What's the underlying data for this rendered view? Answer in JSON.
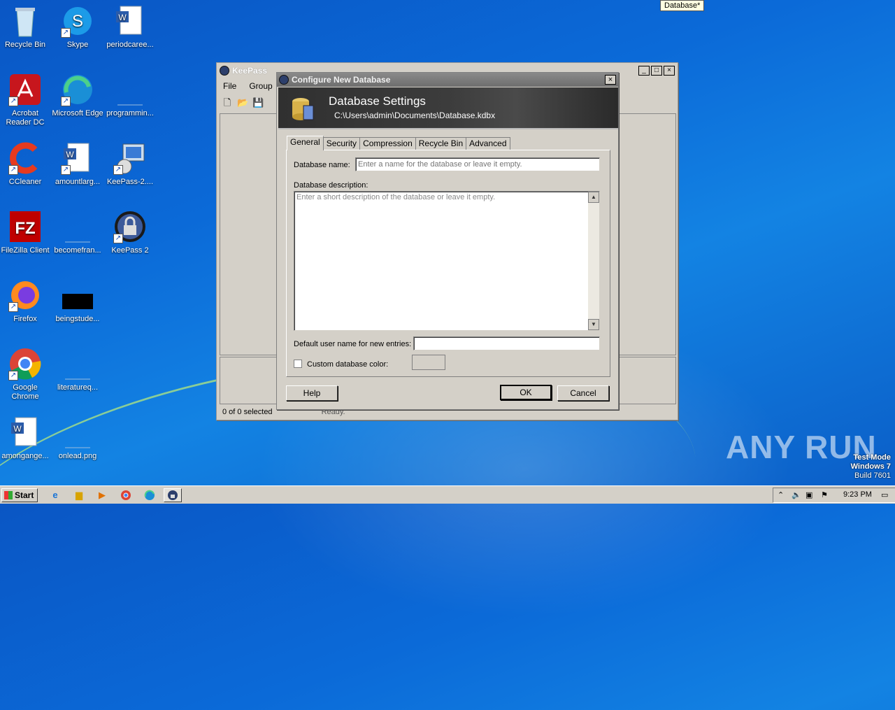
{
  "tooltip": "Database*",
  "desktop_icons": [
    {
      "label": "Recycle Bin",
      "icon": "recycle-bin-icon"
    },
    {
      "label": "Skype",
      "icon": "skype-icon"
    },
    {
      "label": "periodcaree...",
      "icon": "word-doc-icon"
    },
    {
      "label": "Acrobat Reader DC",
      "icon": "acrobat-icon"
    },
    {
      "label": "Microsoft Edge",
      "icon": "edge-icon"
    },
    {
      "label": "programmin...",
      "icon": "file-icon"
    },
    {
      "label": "CCleaner",
      "icon": "ccleaner-icon"
    },
    {
      "label": "amountlarg...",
      "icon": "word-doc-icon"
    },
    {
      "label": "KeePass-2....",
      "icon": "installer-icon"
    },
    {
      "label": "FileZilla Client",
      "icon": "filezilla-icon"
    },
    {
      "label": "becomefran...",
      "icon": "file-icon"
    },
    {
      "label": "KeePass 2",
      "icon": "keepass-icon"
    },
    {
      "label": "Firefox",
      "icon": "firefox-icon"
    },
    {
      "label": "beingstude...",
      "icon": "image-file-icon"
    },
    {
      "label": "Google Chrome",
      "icon": "chrome-icon"
    },
    {
      "label": "literatureq...",
      "icon": "file-icon"
    },
    {
      "label": "amongange...",
      "icon": "word-doc-icon"
    },
    {
      "label": "onlead.png",
      "icon": "file-icon"
    }
  ],
  "keepass": {
    "title": "KeePass",
    "menu": [
      "File",
      "Group"
    ],
    "status_left": "0 of 0 selected",
    "status_right": "Ready."
  },
  "dialog": {
    "title": "Configure New Database",
    "banner_title": "Database Settings",
    "banner_path": "C:\\Users\\admin\\Documents\\Database.kdbx",
    "tabs": [
      "General",
      "Security",
      "Compression",
      "Recycle Bin",
      "Advanced"
    ],
    "active_tab": "General",
    "db_name_label": "Database name:",
    "db_name_value": "",
    "db_name_placeholder": "Enter a name for the database or leave it empty.",
    "db_desc_label": "Database description:",
    "db_desc_placeholder": "Enter a short description of the database or leave it empty.",
    "default_user_label": "Default user name for new entries:",
    "default_user_value": "",
    "custom_color_label": "Custom database color:",
    "custom_color_checked": false,
    "help_label": "Help",
    "ok_label": "OK",
    "cancel_label": "Cancel"
  },
  "watermark": "ANY RUN",
  "os_info": {
    "line1": "Test Mode",
    "line2": "Windows 7",
    "line3": "Build 7601"
  },
  "taskbar": {
    "start_label": "Start",
    "clock": "9:23 PM"
  }
}
